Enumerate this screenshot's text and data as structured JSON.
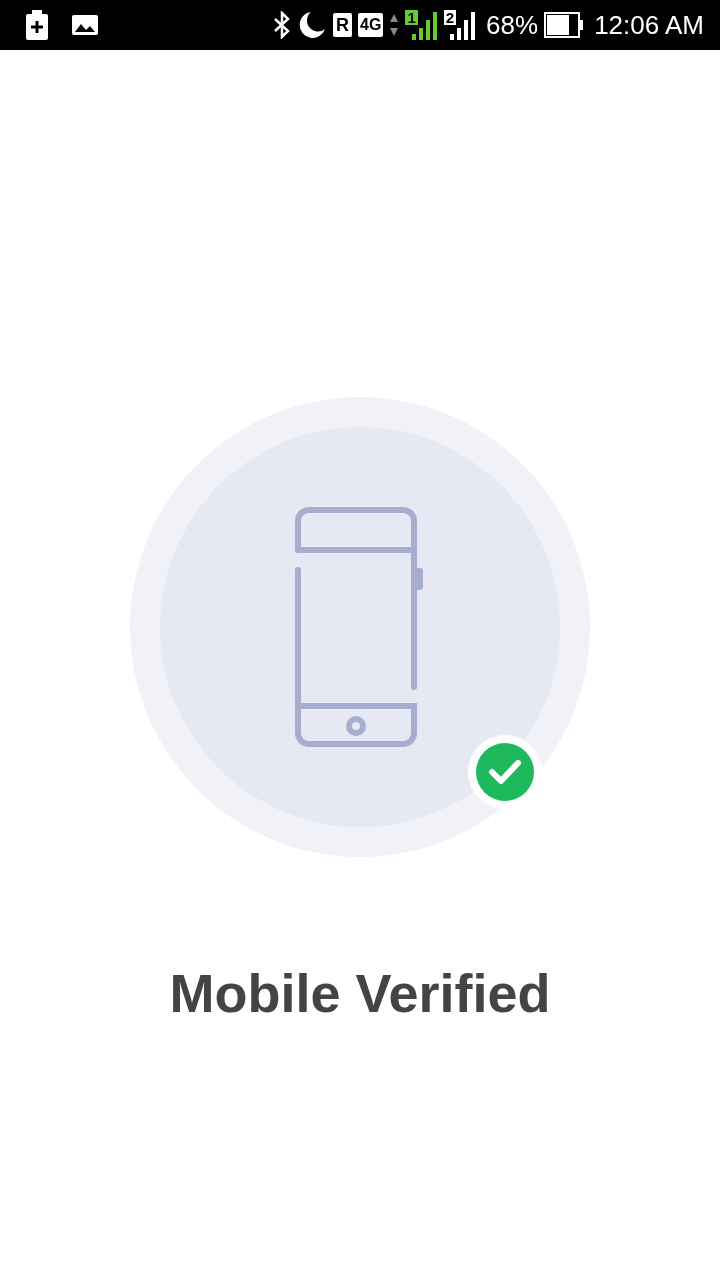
{
  "status_bar": {
    "roaming": "R",
    "network": "4G",
    "sim_1": "1",
    "sim_2": "2",
    "battery_percent": "68%",
    "time": "12:06 AM"
  },
  "verification": {
    "title": "Mobile Verified",
    "verified": true
  }
}
